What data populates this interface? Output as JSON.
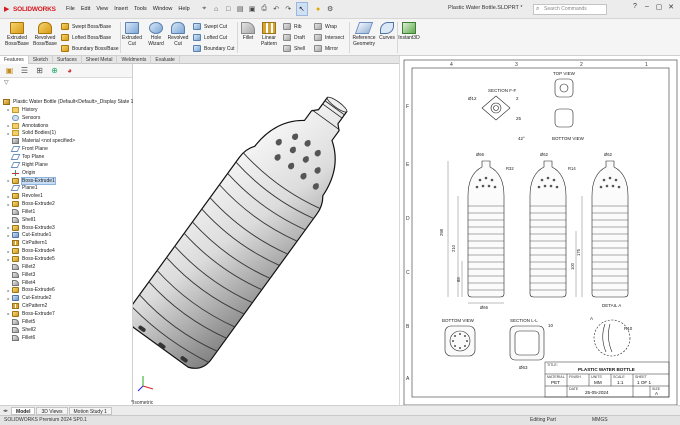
{
  "app": {
    "name": "SOLIDWORKS",
    "document_title": "Plastic Water Bottle.SLDPRT *",
    "search_placeholder": "Search Commands"
  },
  "menu": [
    "File",
    "Edit",
    "View",
    "Insert",
    "Tools",
    "Window",
    "Help"
  ],
  "ribbon": {
    "extruded_boss": "Extruded Boss/Base",
    "revolved_boss": "Revolved Boss/Base",
    "swept_boss": "Swept Boss/Base",
    "lofted_boss": "Lofted Boss/Base",
    "boundary_boss": "Boundary Boss/Base",
    "extruded_cut": "Extruded Cut",
    "hole_wizard": "Hole Wizard",
    "revolved_cut": "Revolved Cut",
    "swept_cut": "Swept Cut",
    "lofted_cut": "Lofted Cut",
    "boundary_cut": "Boundary Cut",
    "fillet": "Fillet",
    "linear_pattern": "Linear Pattern",
    "rib": "Rib",
    "draft": "Draft",
    "shell": "Shell",
    "wrap": "Wrap",
    "intersect": "Intersect",
    "mirror": "Mirror",
    "reference_geometry": "Reference Geometry",
    "curves": "Curves",
    "instant3d": "Instant3D"
  },
  "tabs": [
    "Features",
    "Sketch",
    "Surfaces",
    "Sheet Metal",
    "Weldments",
    "Evaluate"
  ],
  "active_tab": "Features",
  "feature_tree": {
    "root": "Plastic Water Bottle  (Default<Default>_Display State 1)",
    "items": [
      {
        "label": "History",
        "icon": "folder-icon"
      },
      {
        "label": "Sensors",
        "icon": "sensor-icon"
      },
      {
        "label": "Annotations",
        "icon": "annotation-icon"
      },
      {
        "label": "Solid Bodies(1)",
        "icon": "solid-bodies-icon"
      },
      {
        "label": "Material <not specified>",
        "icon": "material-icon"
      },
      {
        "label": "Front Plane",
        "icon": "plane-icon"
      },
      {
        "label": "Top Plane",
        "icon": "plane-icon"
      },
      {
        "label": "Right Plane",
        "icon": "plane-icon"
      },
      {
        "label": "Origin",
        "icon": "origin-icon"
      },
      {
        "label": "Boss-Extrude1",
        "icon": "boss-extrude-icon"
      },
      {
        "label": "Plane1",
        "icon": "plane-icon"
      },
      {
        "label": "Revolve1",
        "icon": "revolve-icon"
      },
      {
        "label": "Boss-Extrude2",
        "icon": "boss-extrude-icon"
      },
      {
        "label": "Fillet1",
        "icon": "fillet-icon"
      },
      {
        "label": "Shell1",
        "icon": "shell-icon"
      },
      {
        "label": "Boss-Extrude3",
        "icon": "boss-extrude-icon"
      },
      {
        "label": "Cut-Extrude1",
        "icon": "cut-extrude-icon"
      },
      {
        "label": "CirPattern1",
        "icon": "circular-pattern-icon"
      },
      {
        "label": "Boss-Extrude4",
        "icon": "boss-extrude-icon"
      },
      {
        "label": "Boss-Extrude5",
        "icon": "boss-extrude-icon"
      },
      {
        "label": "Fillet2",
        "icon": "fillet-icon"
      },
      {
        "label": "Fillet3",
        "icon": "fillet-icon"
      },
      {
        "label": "Fillet4",
        "icon": "fillet-icon"
      },
      {
        "label": "Boss-Extrude6",
        "icon": "boss-extrude-icon"
      },
      {
        "label": "Cut-Extrude2",
        "icon": "cut-extrude-icon"
      },
      {
        "label": "CirPattern2",
        "icon": "circular-pattern-icon"
      },
      {
        "label": "Boss-Extrude7",
        "icon": "boss-extrude-icon"
      },
      {
        "label": "Fillet5",
        "icon": "fillet-icon"
      },
      {
        "label": "Shell2",
        "icon": "shell-icon"
      },
      {
        "label": "Fillet6",
        "icon": "fillet-icon"
      }
    ]
  },
  "viewport": {
    "orientation": "*Isometric"
  },
  "drawing": {
    "top_view": "TOP VIEW",
    "section_ff": "SECTION F-F",
    "bottom_view_top": "BOTTOM VIEW",
    "bottom_view": "BOTTOM VIEW",
    "section_ll": "SECTION L-L",
    "detail_a": "DETAIL A",
    "detail_letter": "A",
    "dims": {
      "d12": "Ø12",
      "r2": "2",
      "d25": "25",
      "a42": "42°",
      "len298": "298",
      "len210": "210",
      "len88": "88",
      "d66": "Ø66",
      "d62": "Ø62",
      "len100": "100",
      "len175": "175",
      "r32": "R32",
      "r14": "R14",
      "r10": "R10",
      "d63": "Ø63",
      "s10": "10"
    },
    "col_labels": [
      "4",
      "3",
      "2",
      "1"
    ],
    "row_labels": [
      "F",
      "E",
      "D",
      "C",
      "B",
      "A"
    ],
    "title_block": {
      "title_label": "TITLE:",
      "title": "PLASTIC WATER BOTTLE",
      "material_label": "MATERIAL",
      "material": "PET",
      "finish_label": "FINISH",
      "units_label": "UNITS",
      "units": "MM",
      "scale_label": "SCALE",
      "scale": "1:1",
      "date_label": "DATE",
      "date": "25-05-2024",
      "sheet_label": "SHEET",
      "sheet": "1 OF 1",
      "size_label": "SIZE",
      "size": "A"
    }
  },
  "bottom_tabs": [
    "Model",
    "3D Views",
    "Motion Study 1"
  ],
  "status": {
    "left": "SOLIDWORKS Premium 2024 SP0.1",
    "mid": "Editing Part",
    "right": "MMGS"
  }
}
